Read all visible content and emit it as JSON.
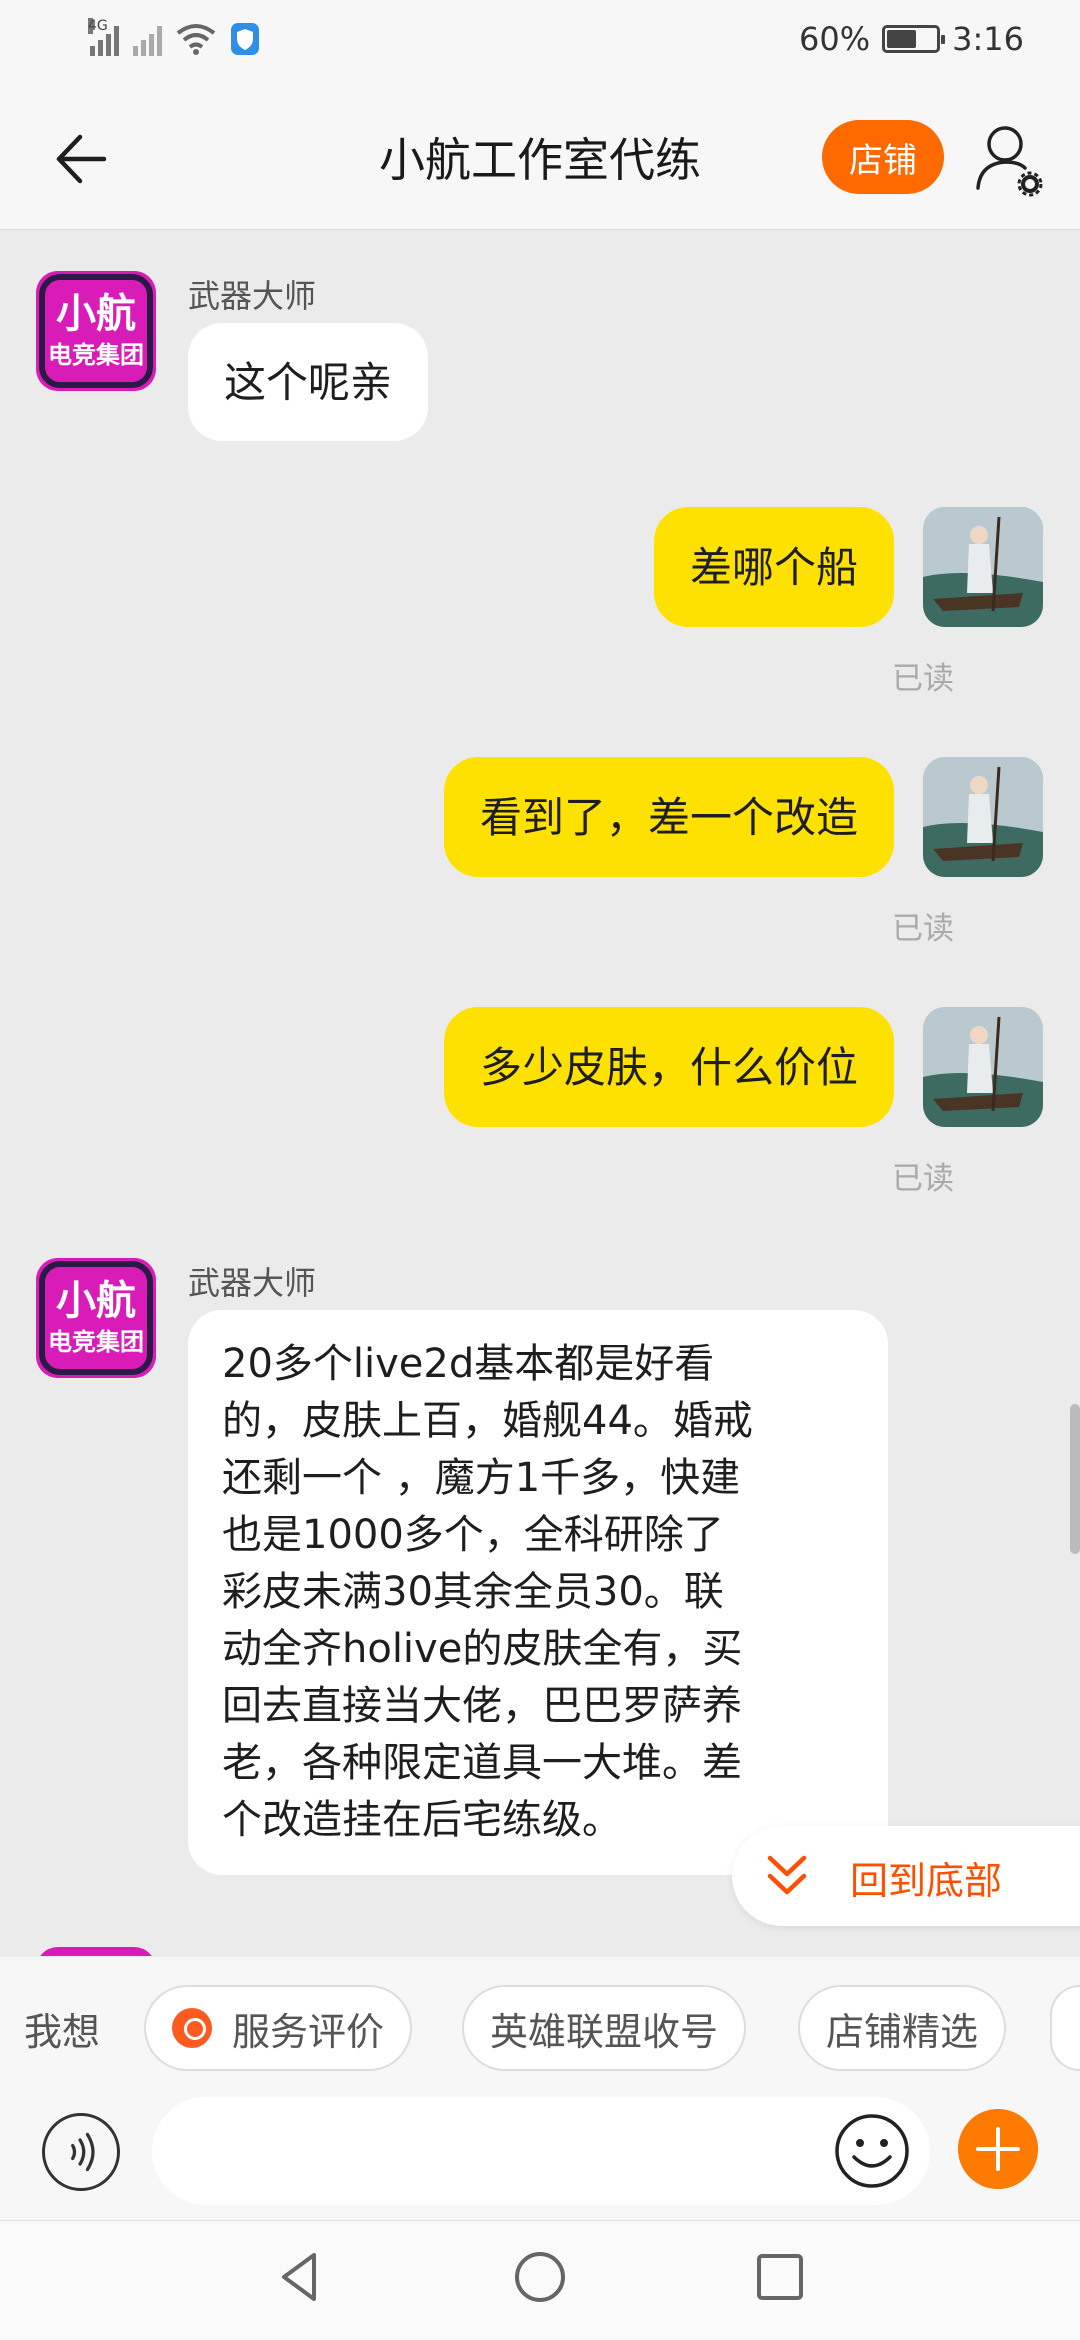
{
  "status_bar": {
    "network_tag": "4G",
    "battery_text": "60%",
    "battery_level": 0.6,
    "time": "3:16",
    "icons": [
      "signal-4g-icon",
      "signal-no-sim-icon",
      "wifi-icon",
      "shield-icon",
      "battery-icon"
    ]
  },
  "header": {
    "title": "小航工作室代练",
    "shop_label": "店铺",
    "back_icon": "back-arrow-icon",
    "profile_icon": "user-settings-icon"
  },
  "messages": [
    {
      "side": "in",
      "sender": "武器大师",
      "text": "这个呢亲"
    },
    {
      "side": "out",
      "text": "差哪个船",
      "status": "已读"
    },
    {
      "side": "out",
      "text": "看到了，差一个改造",
      "status": "已读"
    },
    {
      "side": "out",
      "text": "多少皮肤，什么价位",
      "status": "已读"
    },
    {
      "side": "in",
      "sender": "武器大师",
      "lines": [
        "20多个live2d基本都是好看",
        "的，皮肤上百，婚舰44。婚戒",
        "还剩一个 ，魔方1千多，快建",
        "也是1000多个，全科研除了",
        "彩皮未满30其余全员30。联",
        "动全齐holive的皮肤全有，买",
        "回去直接当大佬，巴巴罗萨养",
        "老，各种限定道具一大堆。差",
        "个改造挂在后宅练级。"
      ]
    }
  ],
  "shop_avatar_text": {
    "line1": "小航",
    "line2": "电竞集团"
  },
  "jump_to_bottom": {
    "label": "回到底部",
    "icon": "double-chevron-down-icon"
  },
  "quick_bar": {
    "prefix": "我想",
    "chips": [
      {
        "label": "服务评价",
        "icon": "service-rating-icon"
      },
      {
        "label": "英雄联盟收号"
      },
      {
        "label": "店铺精选"
      }
    ]
  },
  "input_bar": {
    "value": "",
    "placeholder": "",
    "icons": [
      "voice-icon",
      "emoji-icon",
      "plus-icon"
    ]
  },
  "system_nav": {
    "icons": [
      "nav-back-icon",
      "nav-home-icon",
      "nav-recents-icon"
    ]
  },
  "colors": {
    "accent": "#ff6a00",
    "outgoing_bubble": "#ffe100",
    "background": "#ebebeb",
    "shop_avatar": "#d91cb8"
  }
}
